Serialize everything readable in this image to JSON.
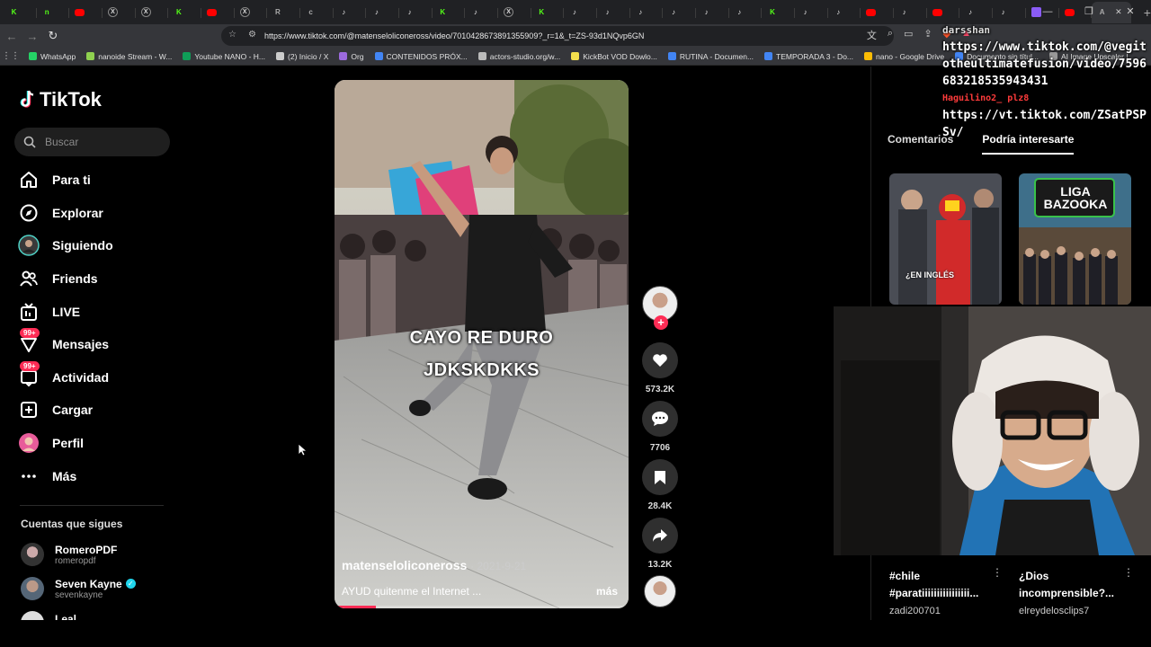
{
  "browser": {
    "tabs": [
      {
        "icon": "kick",
        "glyph": "K"
      },
      {
        "icon": "kick",
        "glyph": "n"
      },
      {
        "icon": "youtube",
        "glyph": ""
      },
      {
        "icon": "x",
        "glyph": "X"
      },
      {
        "icon": "x",
        "glyph": "X"
      },
      {
        "icon": "kick",
        "glyph": "K"
      },
      {
        "icon": "youtube",
        "glyph": ""
      },
      {
        "icon": "x",
        "glyph": "X"
      },
      {
        "icon": "other",
        "glyph": "R"
      },
      {
        "icon": "other",
        "glyph": "c"
      },
      {
        "icon": "tiktok",
        "glyph": "♪"
      },
      {
        "icon": "tiktok",
        "glyph": "♪"
      },
      {
        "icon": "tiktok",
        "glyph": "♪"
      },
      {
        "icon": "kick",
        "glyph": "K"
      },
      {
        "icon": "tiktok",
        "glyph": "♪"
      },
      {
        "icon": "x",
        "glyph": "X"
      },
      {
        "icon": "kick",
        "glyph": "K"
      },
      {
        "icon": "tiktok",
        "glyph": "♪"
      },
      {
        "icon": "tiktok",
        "glyph": "♪"
      },
      {
        "icon": "tiktok",
        "glyph": "♪"
      },
      {
        "icon": "tiktok",
        "glyph": "♪"
      },
      {
        "icon": "tiktok",
        "glyph": "♪"
      },
      {
        "icon": "tiktok",
        "glyph": "♪"
      },
      {
        "icon": "kick",
        "glyph": "K"
      },
      {
        "icon": "tiktok",
        "glyph": "♪"
      },
      {
        "icon": "tiktok",
        "glyph": "♪"
      },
      {
        "icon": "youtube",
        "glyph": ""
      },
      {
        "icon": "tiktok",
        "glyph": "♪"
      },
      {
        "icon": "youtube",
        "glyph": ""
      },
      {
        "icon": "tiktok",
        "glyph": "♪"
      },
      {
        "icon": "tiktok",
        "glyph": "♪"
      },
      {
        "icon": "purple",
        "glyph": ""
      },
      {
        "icon": "youtube",
        "glyph": ""
      },
      {
        "icon": "active",
        "glyph": "A"
      }
    ],
    "url": "https://www.tiktok.com/@matenseloliconeross/video/7010428673891355909?_r=1&_t=ZS-93d1NQvp6GN",
    "bookmarks": [
      {
        "label": "WhatsApp",
        "color": "#25d366"
      },
      {
        "label": "nanoide Stream - W...",
        "color": "#8fd14f"
      },
      {
        "label": "Youtube NANO - H...",
        "color": "#0f9d58"
      },
      {
        "label": "(2) Inicio / X",
        "color": "#cccccc"
      },
      {
        "label": "Org",
        "color": "#9c6ade"
      },
      {
        "label": "CONTENIDOS PRÓX...",
        "color": "#4285f4"
      },
      {
        "label": "actors-studio.org/w...",
        "color": "#bbbbbb"
      },
      {
        "label": "KickBot VOD Dowlo...",
        "color": "#f4e04d"
      },
      {
        "label": "RUTINA - Documen...",
        "color": "#4285f4"
      },
      {
        "label": "TEMPORADA 3 - Do...",
        "color": "#4285f4"
      },
      {
        "label": "nano - Google Drive",
        "color": "#fbbc04"
      },
      {
        "label": "Documento sin títul...",
        "color": "#4285f4"
      },
      {
        "label": "AI Image Upscaler |...",
        "color": "#999999"
      }
    ]
  },
  "sidebar": {
    "logo": "TikTok",
    "search_placeholder": "Buscar",
    "nav": [
      {
        "label": "Para ti",
        "icon": "home-icon"
      },
      {
        "label": "Explorar",
        "icon": "compass-icon"
      },
      {
        "label": "Siguiendo",
        "icon": "following-avatar-icon"
      },
      {
        "label": "Friends",
        "icon": "friends-icon"
      },
      {
        "label": "LIVE",
        "icon": "live-icon"
      },
      {
        "label": "Mensajes",
        "icon": "messages-icon",
        "badge": "99+"
      },
      {
        "label": "Actividad",
        "icon": "activity-icon",
        "badge": "99+"
      },
      {
        "label": "Cargar",
        "icon": "upload-icon"
      },
      {
        "label": "Perfil",
        "icon": "profile-avatar-icon"
      },
      {
        "label": "Más",
        "icon": "more-icon"
      }
    ],
    "following_title": "Cuentas que sigues",
    "following": [
      {
        "name": "RomeroPDF",
        "handle": "romeropdf",
        "verified": false
      },
      {
        "name": "Seven Kayne",
        "handle": "sevenkayne",
        "verified": true
      },
      {
        "name": "Leal",
        "handle": "",
        "verified": false
      }
    ]
  },
  "video": {
    "overlay_line1": "CAYO RE DURO",
    "overlay_line2": "JDKSKDKKS",
    "author": "matenseloliconeross",
    "date": "· 2021-9-21",
    "caption": "AYUD quitenme el Internet ...",
    "more": "más",
    "progress_fraction": 0.14
  },
  "actions": {
    "likes": "573.2K",
    "comments": "7706",
    "saves": "28.4K",
    "shares": "13.2K"
  },
  "right_panel": {
    "tabs": [
      "Comentarios",
      "Podría interesarte"
    ],
    "cards": [
      {
        "caption": "#chile #paratiiiiiiiiiiiiiiii...",
        "author": "zadi200701",
        "thumb_text": "¿EN INGLÉS"
      },
      {
        "caption": "¿Dios incomprensible?...",
        "author": "elreydelosclips7",
        "thumb_text": "LIGA BAZOOKA"
      }
    ]
  },
  "stream_overlay": {
    "user1": "darsshan",
    "url1": "https://www.tiktok.com/@vegitotheultimatefusion/video/7596683218535943431",
    "user2": "Haguilino2_ plz8",
    "url2": "https://vt.tiktok.com/ZSatPSPSv/"
  },
  "colors": {
    "accent": "#fe2c55",
    "background": "#000000",
    "verified": "#20d5ec"
  }
}
